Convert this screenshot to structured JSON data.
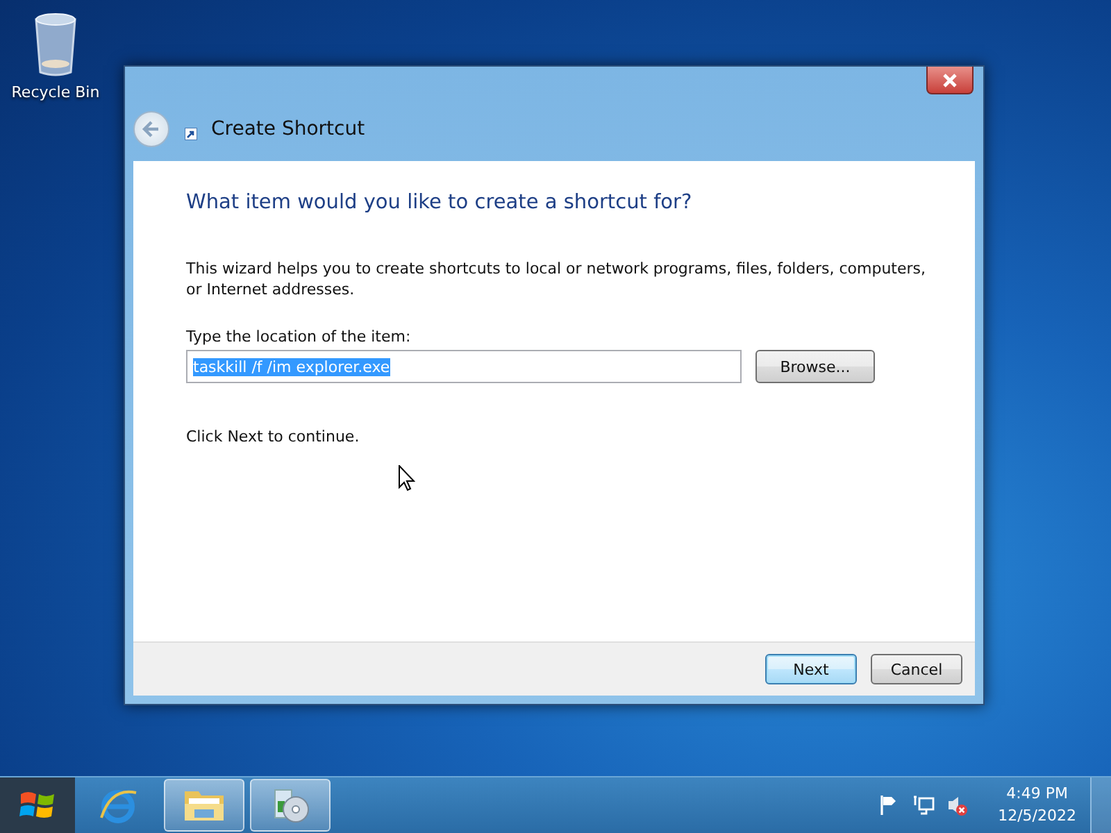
{
  "desktop": {
    "icons": [
      {
        "label": "Recycle Bin"
      }
    ]
  },
  "dialog": {
    "title": "Create Shortcut",
    "heading": "What item would you like to create a shortcut for?",
    "description": "This wizard helps you to create shortcuts to local or network programs, files, folders, computers, or Internet addresses.",
    "field_label": "Type the location of the item:",
    "field": {
      "value": "taskkill /f /im explorer.exe",
      "text_selected": true
    },
    "browse_button": "Browse...",
    "hint": "Click Next to continue.",
    "buttons": [
      {
        "label": "Next",
        "default": true
      },
      {
        "label": "Cancel",
        "default": false
      }
    ]
  },
  "taskbar": {
    "apps": [
      {
        "kind": "browser",
        "running": false
      },
      {
        "kind": "folder",
        "running": true
      },
      {
        "kind": "media",
        "running": true
      }
    ],
    "tray": {
      "volume_muted": true,
      "time": "4:49 PM",
      "date": "12/5/2022"
    }
  }
}
